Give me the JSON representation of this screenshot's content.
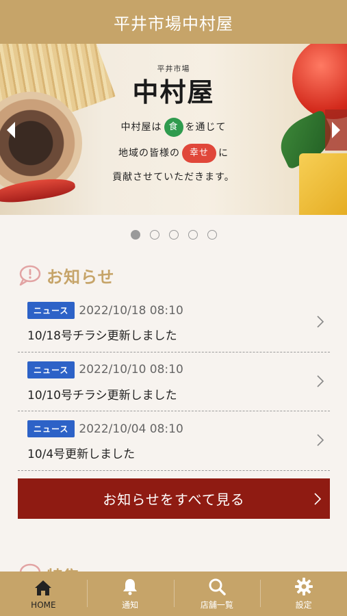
{
  "header": {
    "title": "平井市場中村屋"
  },
  "banner": {
    "brand_small": "平井市場",
    "brand_big": "中村屋",
    "line1_pre": "中村屋は",
    "line1_circle": "食",
    "line1_post": "を通じて",
    "line2_pre": "地域の皆様の",
    "line2_circle": "幸せ",
    "line2_post": "に",
    "line3": "貢献させていただきます。",
    "slide_count": 5,
    "active_slide": 1
  },
  "news_section": {
    "title": "お知らせ",
    "items": [
      {
        "badge": "ニュース",
        "date": "2022/10/18 08:10",
        "headline": "10/18号チラシ更新しました"
      },
      {
        "badge": "ニュース",
        "date": "2022/10/10 08:10",
        "headline": "10/10号チラシ更新しました"
      },
      {
        "badge": "ニュース",
        "date": "2022/10/04 08:10",
        "headline": "10/4号更新しました"
      }
    ],
    "more_label": "お知らせをすべて見る"
  },
  "next_section": {
    "title": "特集"
  },
  "tabbar": {
    "tabs": [
      {
        "label": "HOME",
        "icon": "home-icon"
      },
      {
        "label": "通知",
        "icon": "bell-icon"
      },
      {
        "label": "店舗一覧",
        "icon": "search-icon"
      },
      {
        "label": "設定",
        "icon": "gear-icon"
      }
    ]
  },
  "colors": {
    "header": "#c6a469",
    "more_button": "#8f1b12",
    "badge": "#2d62c7",
    "section_title": "#c6a469"
  }
}
